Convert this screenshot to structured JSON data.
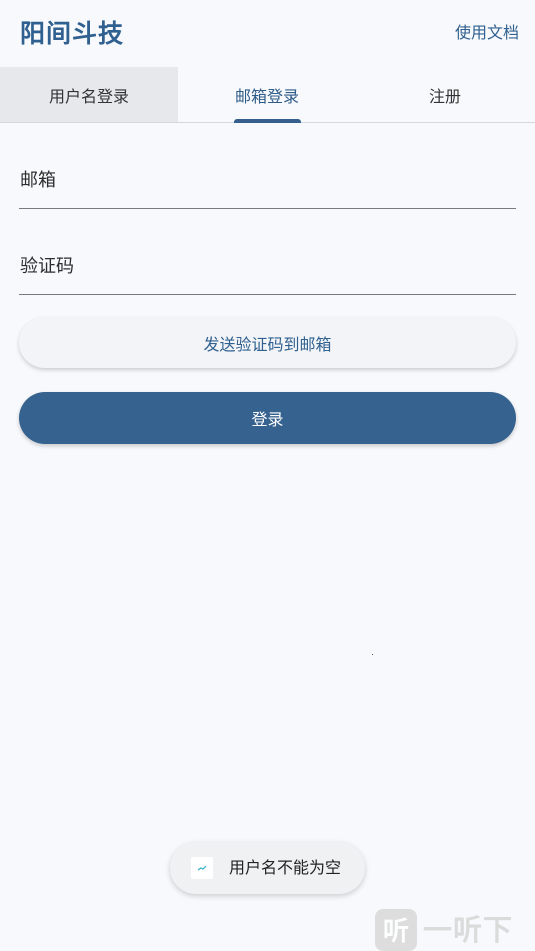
{
  "header": {
    "app_title": "阳间斗技",
    "docs_link": "使用文档"
  },
  "tabs": [
    {
      "label": "用户名登录",
      "state": "hover"
    },
    {
      "label": "邮箱登录",
      "state": "active"
    },
    {
      "label": "注册",
      "state": "normal"
    }
  ],
  "form": {
    "email_label": "邮箱",
    "code_label": "验证码",
    "send_code_label": "发送验证码到邮箱",
    "login_label": "登录"
  },
  "toast": {
    "message": "用户名不能为空",
    "icon": "app-icon"
  },
  "watermark": {
    "text": "一听下载",
    "logo_glyph": "听",
    "icon": "tingo-logo-icon"
  },
  "colors": {
    "primary": "#35628f",
    "title": "#30608f",
    "background": "#f7f9fc"
  }
}
